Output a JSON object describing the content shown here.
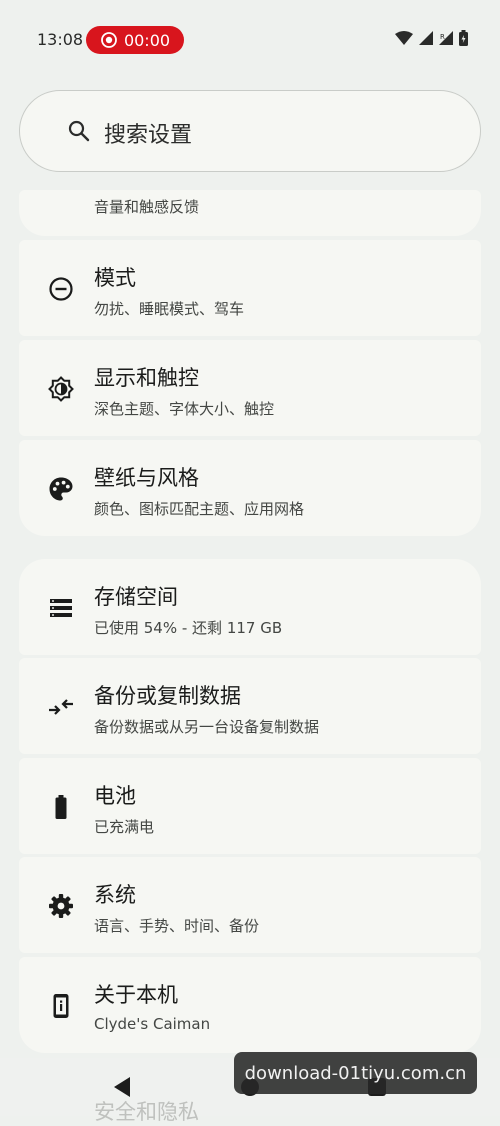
{
  "status_bar": {
    "time": "13:08",
    "recording": "00:00"
  },
  "search": {
    "placeholder": "搜索设置"
  },
  "settings": {
    "partial_item": {
      "subtitle": "音量和触感反馈"
    },
    "group1": [
      {
        "title": "模式",
        "subtitle": "勿扰、睡眠模式、驾车",
        "icon": "modes-icon"
      },
      {
        "title": "显示和触控",
        "subtitle": "深色主题、字体大小、触控",
        "icon": "display-icon"
      },
      {
        "title": "壁纸与风格",
        "subtitle": "颜色、图标匹配主题、应用网格",
        "icon": "palette-icon"
      }
    ],
    "group2": [
      {
        "title": "存储空间",
        "subtitle": "已使用 54% - 还剩 117 GB",
        "icon": "storage-icon"
      },
      {
        "title": "备份或复制数据",
        "subtitle": "备份数据或从另一台设备复制数据",
        "icon": "backup-icon"
      },
      {
        "title": "电池",
        "subtitle": "已充满电",
        "icon": "battery-icon"
      },
      {
        "title": "系统",
        "subtitle": "语言、手势、时间、备份",
        "icon": "gear-icon"
      },
      {
        "title": "关于本机",
        "subtitle": "Clyde's Caiman",
        "icon": "phone-info-icon"
      }
    ],
    "next_item_title": "安全和隐私"
  },
  "watermark": "download-01tiyu.com.cn"
}
